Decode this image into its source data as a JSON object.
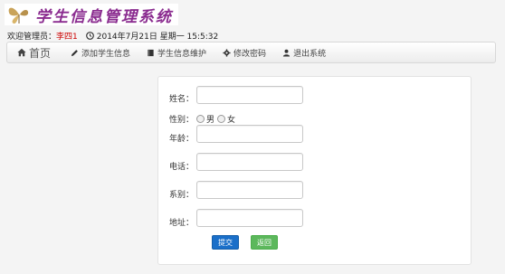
{
  "header": {
    "logo_icon": "butterfly-logo-icon",
    "logo_text": "学生信息管理系统"
  },
  "info": {
    "welcome_label": "欢迎管理员：",
    "admin_name": "李四1",
    "clock_icon": "clock-icon",
    "datetime": "2014年7月21日 星期一 15:5:32"
  },
  "nav": {
    "home": "首页",
    "add_student": "添加学生信息",
    "maintain_student": "学生信息维护",
    "change_password": "修改密码",
    "exit": "退出系统"
  },
  "form": {
    "name_label": "姓名：",
    "gender_label": "性别：",
    "male": "男",
    "female": "女",
    "age_label": "年龄：",
    "phone_label": "电话：",
    "dept_label": "系别：",
    "address_label": "地址：",
    "submit": "提交",
    "back": "返回"
  },
  "colors": {
    "brand": "#8a2b8f",
    "admin_name": "#cc0000",
    "primary_button": "#1a6fc9",
    "success_button": "#5cb85c"
  }
}
